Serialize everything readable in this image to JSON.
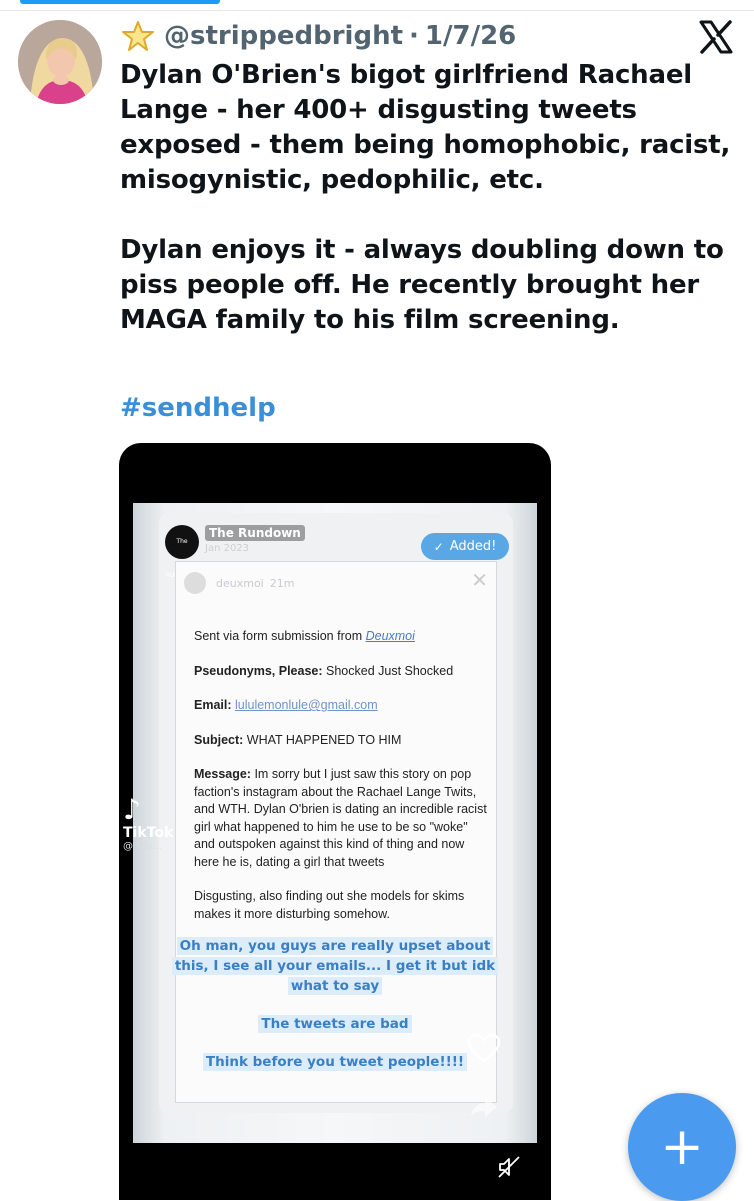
{
  "tweet": {
    "handle": "@strippedbright",
    "date": "1/7/26",
    "paragraph1": "Dylan O'Brien's bigot girlfriend Rachael Lange - her 400+ disgusting tweets exposed - them being homophobic, racist, misogynistic, pedophilic, etc.",
    "paragraph2": "Dylan enjoys it - always doubling down to piss people off. He recently brought her MAGA family to his film screening.",
    "hashtag": "#sendhelp",
    "icons": {
      "badge": "star-icon",
      "platform": "x-logo-icon"
    }
  },
  "media": {
    "story_account": "The Rundown",
    "story_logo_text": "The RUNDOWN",
    "story_date": "Jan 2023",
    "added_label": "Added!",
    "inner_account": "deuxmoi",
    "inner_time": "21m",
    "form": {
      "sent_via_prefix": "Sent via form submission from ",
      "sent_via_link": "Deuxmoi",
      "pseudonym_label": "Pseudonyms, Please:",
      "pseudonym_value": " Shocked Just Shocked",
      "email_label": "Email:",
      "email_value": "lululemonlule@gmail.com",
      "subject_label": "Subject:",
      "subject_value": " WHAT HAPPENED TO HIM",
      "message_label": "Message:",
      "message_value": " Im sorry but I just saw this story on pop faction's instagram about the Rachael Lange Twits, and WTH. Dylan O'brien is dating an incredible racist girl what happened to him he use to be so \"woke\" and outspoken against this kind of thing and now here he is, dating a girl that tweets",
      "closing": "Disgusting, also finding out she models for skims makes it more disturbing somehow."
    },
    "captions": [
      "Oh man, you guys are really upset about this, I see all your emails... I get it but idk what to say",
      "The tweets are bad",
      "Think before you tweet people!!!!"
    ],
    "tiktok_name": "TikTok",
    "tiktok_user": "@ fau..."
  },
  "fab": {
    "label": "+",
    "icon": "plus-icon"
  },
  "colors": {
    "accent": "#1d9bf0",
    "hashtag": "#3b8fd8",
    "fab": "#4a9bf0"
  }
}
